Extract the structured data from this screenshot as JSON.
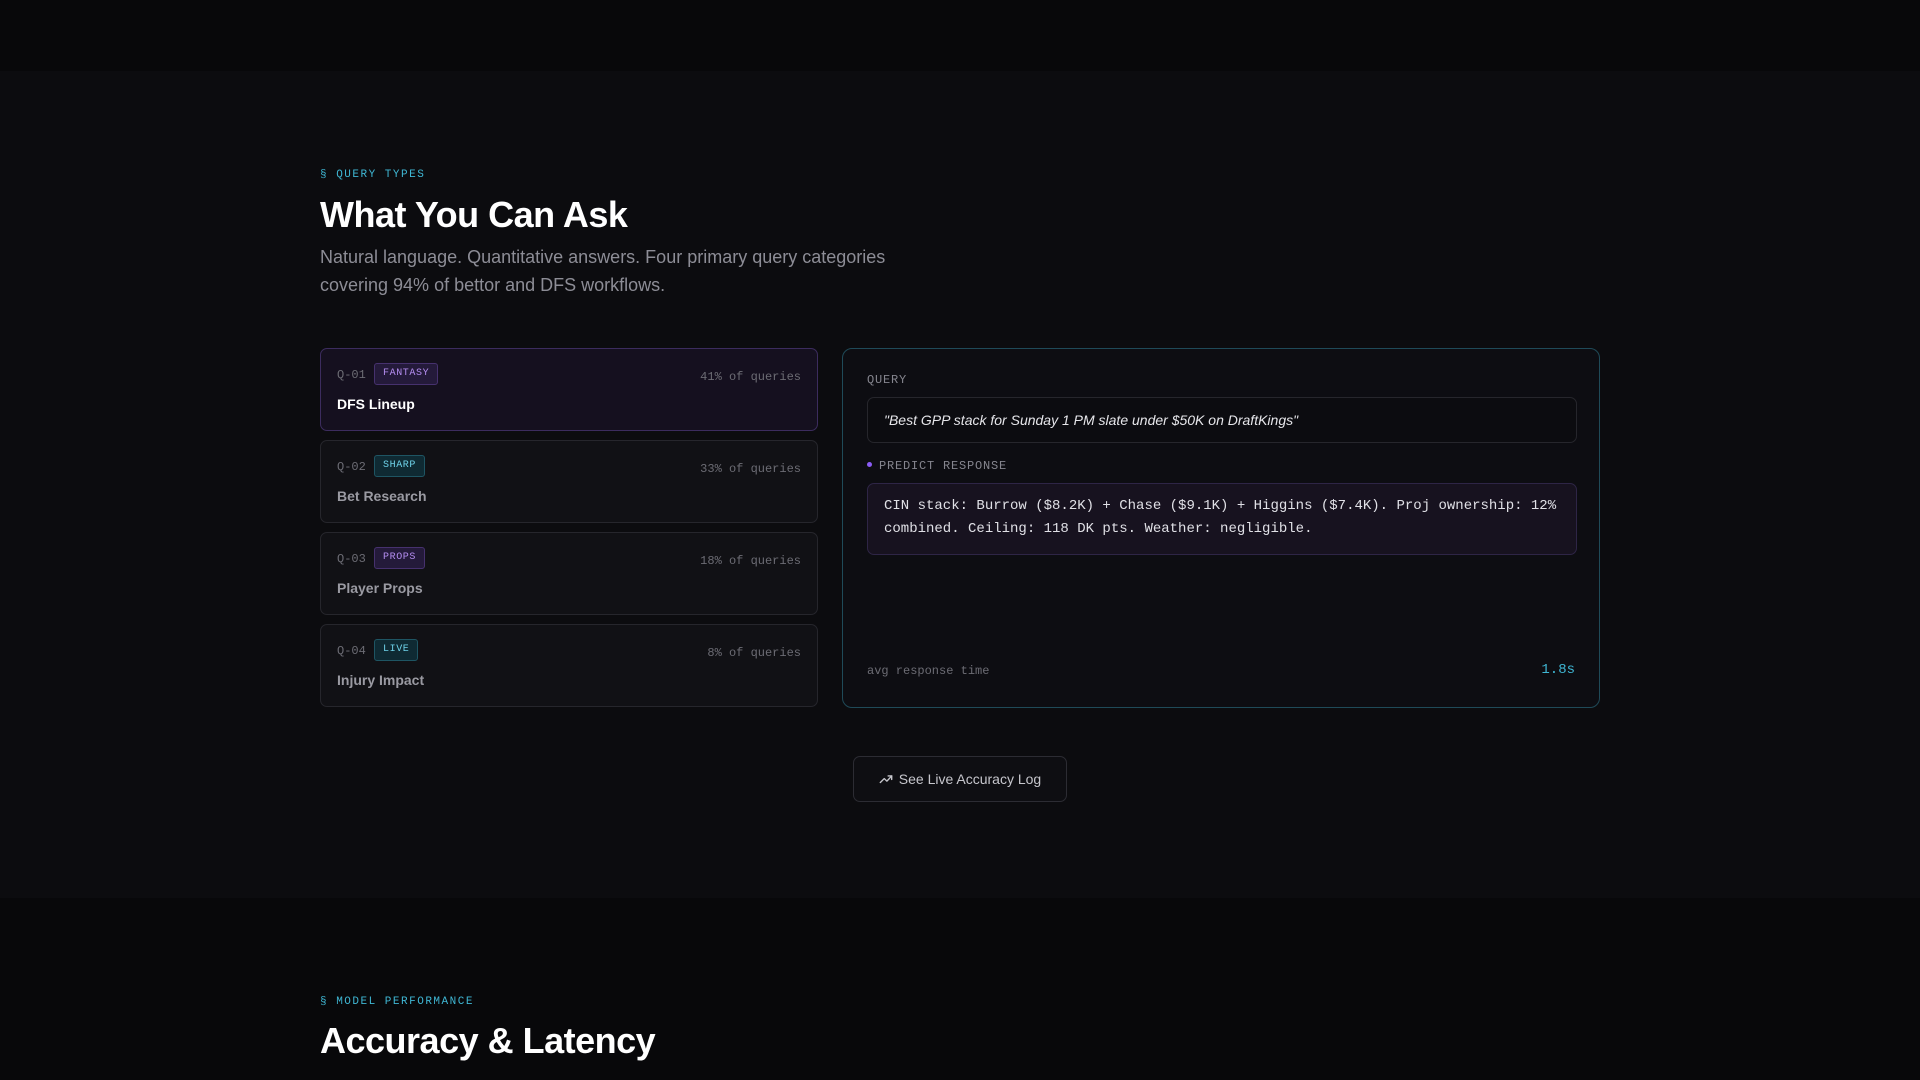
{
  "query_types": {
    "eyebrow": "§ QUERY TYPES",
    "title": "What You Can Ask",
    "lead": "Natural language. Quantitative answers. Four primary query categories covering 94% of bettor and DFS workflows.",
    "cards": [
      {
        "num": "Q-01",
        "badge": "FANTASY",
        "badge_color": "purple",
        "pct": "41% of queries",
        "title": "DFS Lineup",
        "active": true
      },
      {
        "num": "Q-02",
        "badge": "SHARP",
        "badge_color": "cyan",
        "pct": "33% of queries",
        "title": "Bet Research",
        "active": false
      },
      {
        "num": "Q-03",
        "badge": "PROPS",
        "badge_color": "purple",
        "pct": "18% of queries",
        "title": "Player Props",
        "active": false
      },
      {
        "num": "Q-04",
        "badge": "LIVE",
        "badge_color": "cyan",
        "pct": "8% of queries",
        "title": "Injury Impact",
        "active": false
      }
    ],
    "panel": {
      "query_label": "QUERY",
      "query_text": "\"Best GPP stack for Sunday 1 PM slate under $50K on DraftKings\"",
      "response_label": "PREDICT RESPONSE",
      "response_text": "CIN stack: Burrow ($8.2K) + Chase ($9.1K) + Higgins ($7.4K). Proj ownership: 12% combined. Ceiling: 118 DK pts. Weather: negligible.",
      "avg_label": "avg response time",
      "avg_value": "1.8s"
    },
    "cta_label": "See Live Accuracy Log",
    "cta_icon": "trending-up-icon"
  },
  "model_performance": {
    "eyebrow": "§ MODEL PERFORMANCE",
    "title": "Accuracy & Latency"
  },
  "colors": {
    "accent_cyan": "#3fb7d4",
    "accent_purple": "#8b5cf6",
    "background": "#0c0c0f"
  }
}
